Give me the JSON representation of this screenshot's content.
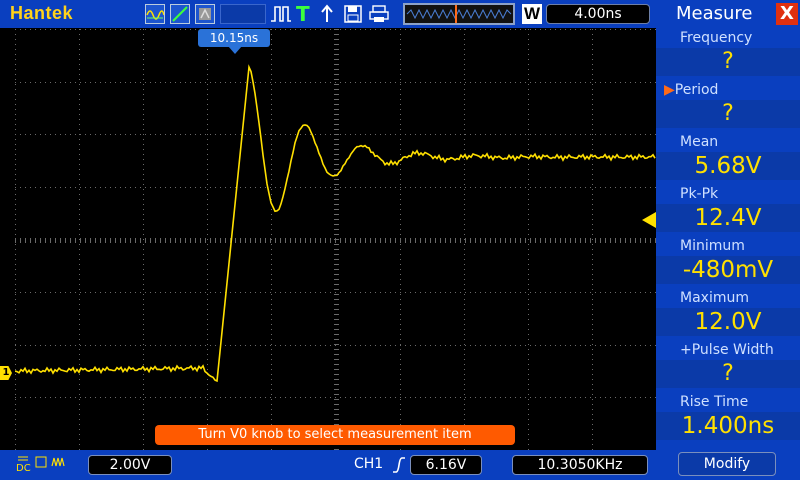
{
  "topbar": {
    "brand": "Hantek",
    "icons": [
      "math-wave-icon",
      "slope-icon",
      "persistence-icon",
      "pulse-icon",
      "trigger-T-icon",
      "arrow-icon",
      "save-disk-icon",
      "print-icon"
    ],
    "t_label": "T",
    "w_label": "W",
    "timebase": "4.00ns"
  },
  "screen": {
    "trigger_position": "10.15ns",
    "channel_marker": "1",
    "hint": "Turn V0 knob to select measurement item",
    "trace_color": "#ffe000"
  },
  "bottombar": {
    "coupling": "DC",
    "volts_div": "2.00V",
    "trigger_channel": "CH1",
    "trigger_level": "6.16V",
    "frequency": "10.3050KHz"
  },
  "panel": {
    "title": "Measure",
    "close_label": "X",
    "selected_marker": "▶",
    "items": [
      {
        "label": "Frequency",
        "value": "?"
      },
      {
        "label": "Period",
        "value": "?"
      },
      {
        "label": "Mean",
        "value": "5.68V"
      },
      {
        "label": "Pk-Pk",
        "value": "12.4V"
      },
      {
        "label": "Minimum",
        "value": "-480mV"
      },
      {
        "label": "Maximum",
        "value": "12.0V"
      },
      {
        "label": "+Pulse Width",
        "value": "?"
      },
      {
        "label": "Rise Time",
        "value": "1.400ns"
      }
    ],
    "modify_label": "Modify"
  },
  "colors": {
    "bar_blue": "#0a3fbf",
    "value_yellow": "#ffe000",
    "hint_orange": "#ff5a00"
  }
}
